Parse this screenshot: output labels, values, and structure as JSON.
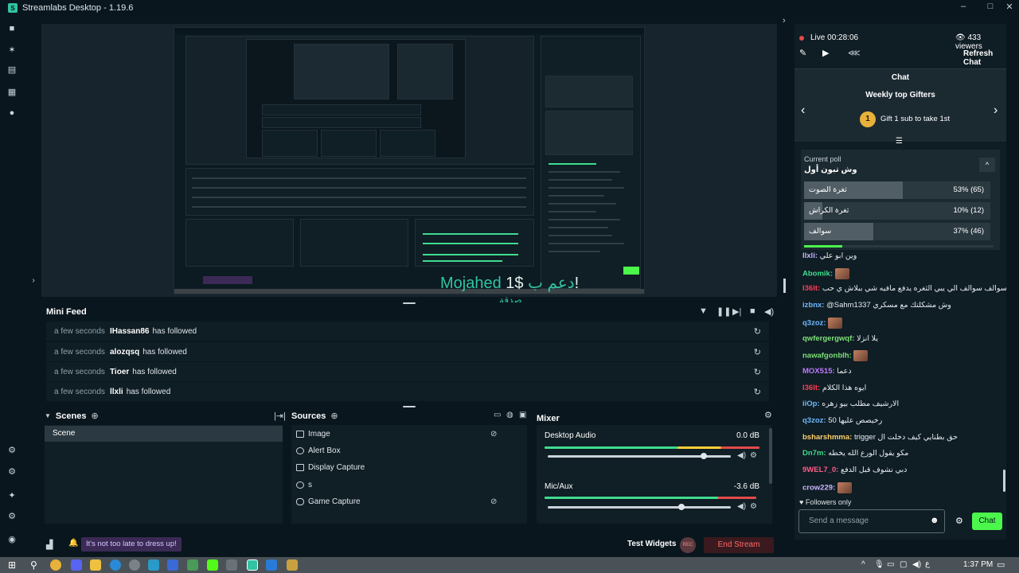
{
  "window": {
    "title": "Streamlabs Desktop - 1.19.6",
    "logo_glyph": "S"
  },
  "window_controls": {
    "minimize": "–",
    "maximize": "□",
    "close": "✕"
  },
  "preview": {
    "donation_user": "Mojahed",
    "donation_text": "دعم ب",
    "donation_amount": "$1!",
    "donation_sub": "صدقة"
  },
  "mini_feed": {
    "title": "Mini Feed",
    "items": [
      {
        "time": "a few seconds",
        "user": "IHassan86",
        "action": "has followed"
      },
      {
        "time": "a few seconds",
        "user": "alozqsq",
        "action": "has followed"
      },
      {
        "time": "a few seconds",
        "user": "Tioer",
        "action": "has followed"
      },
      {
        "time": "a few seconds",
        "user": "llxli",
        "action": "has followed"
      }
    ]
  },
  "scenes": {
    "title": "Scenes",
    "items": [
      "Scene"
    ]
  },
  "sources": {
    "title": "Sources",
    "items": [
      "Image",
      "Alert Box",
      "Display Capture",
      "s",
      "Game Capture"
    ]
  },
  "mixer": {
    "title": "Mixer",
    "tracks": [
      {
        "name": "Desktop Audio",
        "db": "0.0 dB",
        "volume": 0.85,
        "level": 0.85
      },
      {
        "name": "Mic/Aux",
        "db": "-3.6 dB",
        "volume": 0.73,
        "level": 0.98
      }
    ]
  },
  "footer": {
    "tip": "It's not too late to dress up!",
    "test_widgets": "Test Widgets",
    "rec": "REC",
    "end_stream": "End Stream"
  },
  "chat": {
    "live_label": "Live",
    "live_time": "00:28:06",
    "viewers": "433 viewers",
    "refresh": "Refresh Chat",
    "title": "Chat",
    "gifters_title": "Weekly top Gifters",
    "gift_rank": "1",
    "gift_text": "Gift 1 sub to take 1st",
    "poll_label": "Current poll",
    "poll_question": "وش تبون أول",
    "poll_options": [
      {
        "label": "ثغرة الصوت",
        "value": "53% (65)",
        "pct": 53
      },
      {
        "label": "ثغرة الكراش",
        "value": "10% (12)",
        "pct": 10
      },
      {
        "label": "سوالف",
        "value": "37% (46)",
        "pct": 37
      }
    ],
    "messages": [
      {
        "name": "llxli:",
        "text": "وين ابو علي",
        "color": "#c9b4ff"
      },
      {
        "name": "Abomik:",
        "text": "",
        "color": "#3fdc8f",
        "emote": true
      },
      {
        "name": "I36lt:",
        "text": "سوالف سوالف الي يبي الثغره يدفع مافيه شي ببلاش ي حب",
        "color": "#ff3b53"
      },
      {
        "name": "izbnx:",
        "text": "@Sahm1337 وش مشكلتك مع مسكري",
        "color": "#6fb9ff"
      },
      {
        "name": "q3zoz:",
        "text": "",
        "color": "#6fb9ff",
        "emote": true
      },
      {
        "name": "qwfergergwqf:",
        "text": "يلا انزلا",
        "color": "#7fe07a"
      },
      {
        "name": "nawafgonblh:",
        "text": "",
        "color": "#7fe07a",
        "emote": true
      },
      {
        "name": "MOX515:",
        "text": "دعما",
        "color": "#c07aff"
      },
      {
        "name": "I36lt:",
        "text": "ايوه هذا الكلام",
        "color": "#ff3b53"
      },
      {
        "name": "iiOp:",
        "text": "الارشيف مطلب بيو زهره",
        "color": "#6fb9ff"
      },
      {
        "name": "q3zoz:",
        "text": "50 رخيصص عليها",
        "color": "#6fb9ff"
      },
      {
        "name": "bsharshmma:",
        "text": "trigger حق بطنايي كيف دخلت ال",
        "color": "#ffcf6a"
      },
      {
        "name": "Dn7m:",
        "text": "مكو يقول الورع الله يخطه",
        "color": "#3fdc8f"
      },
      {
        "name": "9WEL7_0:",
        "text": "دبي نشوف قبل الدفع",
        "color": "#ff5b8a"
      },
      {
        "name": "crow229:",
        "text": "",
        "color": "#c9b4ff",
        "emote": true
      }
    ],
    "followers_only": "Followers only",
    "input_placeholder": "Send a message",
    "send_label": "Chat"
  },
  "taskbar": {
    "time": "1:37 PM",
    "lang": "ع"
  },
  "colors": {
    "accent": "#31c3a2",
    "live_red": "#e24b4b",
    "end_stream_bg": "#3a1a1e",
    "end_stream_text": "#ff6a6a",
    "send_green": "#4cf74c"
  }
}
